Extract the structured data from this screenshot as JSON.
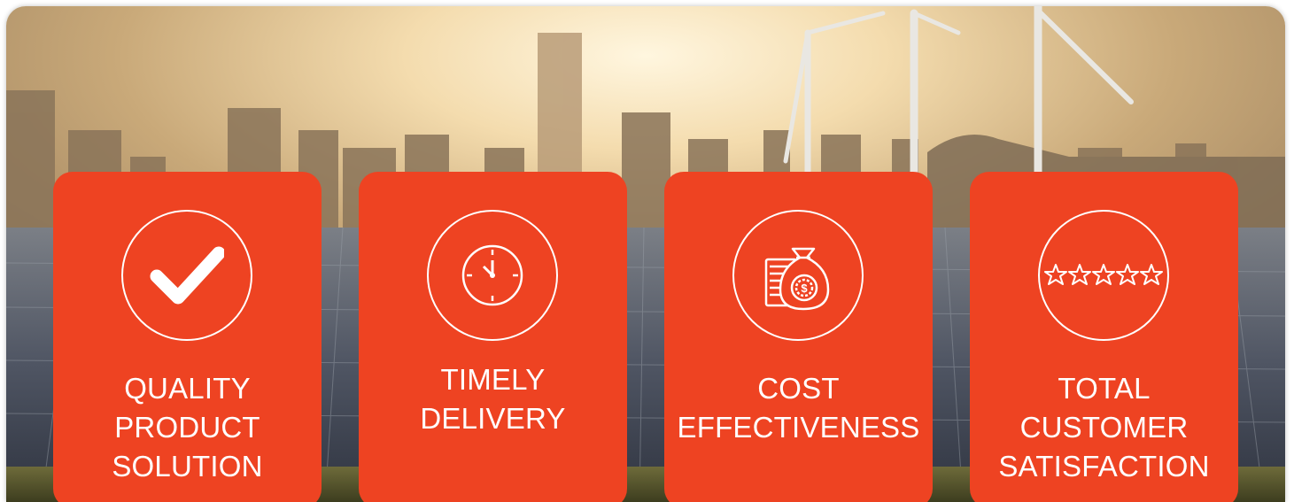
{
  "cards": [
    {
      "name": "quality",
      "lines": [
        "QUALITY",
        "PRODUCT",
        "SOLUTION"
      ],
      "icon": "checkmark-icon"
    },
    {
      "name": "timely",
      "lines": [
        "TIMELY",
        "DELIVERY"
      ],
      "icon": "clock-icon"
    },
    {
      "name": "cost",
      "lines": [
        "COST",
        "EFFECTIVENESS"
      ],
      "icon": "money-bag-icon"
    },
    {
      "name": "satisfaction",
      "lines": [
        "TOTAL",
        "CUSTOMER",
        "SATISFACTION"
      ],
      "icon": "five-stars-icon"
    }
  ],
  "colors": {
    "card": "#ee4322",
    "icon": "#ffffff"
  }
}
